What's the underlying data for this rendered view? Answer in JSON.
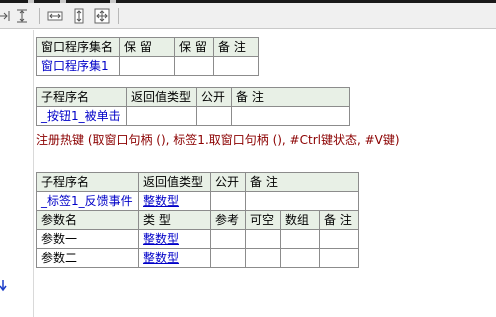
{
  "program_set_table": {
    "headers": [
      "窗口程序集名",
      "保 留",
      "保 留",
      "备 注"
    ],
    "row": [
      "窗口程序集1",
      "",
      "",
      ""
    ]
  },
  "sub1_table": {
    "headers": [
      "子程序名",
      "返回值类型",
      "公开",
      "备 注"
    ],
    "row": [
      "_按钮1_被单击",
      "",
      "",
      ""
    ]
  },
  "hotkey_code": "注册热键 (取窗口句柄 (), 标签1.取窗口句柄 (), #Ctrl键状态, #V键)",
  "sub2_table": {
    "headers": [
      "子程序名",
      "返回值类型",
      "公开",
      "备 注"
    ],
    "row": [
      "_标签1_反馈事件",
      "整数型",
      "",
      ""
    ],
    "param_headers": [
      "参数名",
      "类 型",
      "参考",
      "可空",
      "数组",
      "备 注"
    ],
    "params": [
      [
        "参数一",
        "整数型",
        "",
        "",
        "",
        ""
      ],
      [
        "参数二",
        "整数型",
        "",
        "",
        "",
        ""
      ]
    ]
  }
}
